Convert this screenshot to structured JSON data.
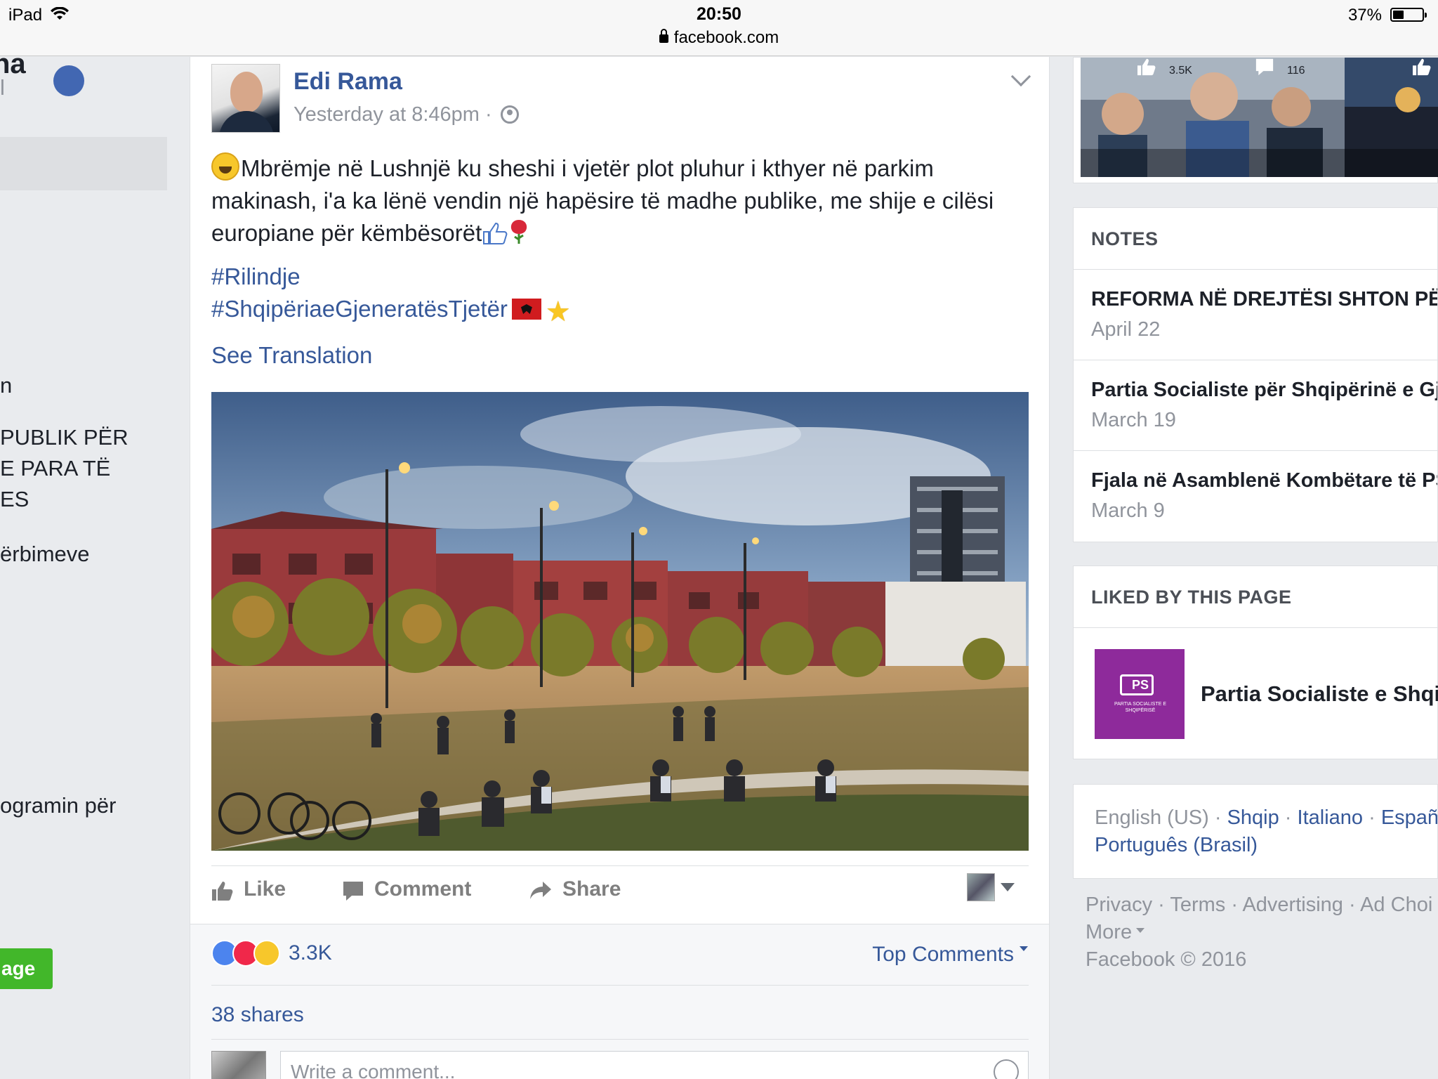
{
  "status_bar": {
    "device": "iPad",
    "time": "20:50",
    "url": "facebook.com",
    "battery": "37%"
  },
  "left_sidebar": {
    "partial_title": "na",
    "partial_subtitle": "l",
    "lines": [
      "n",
      "PUBLIK PËR",
      "E PARA TË",
      "ES",
      "ërbimeve",
      "ogramin për"
    ],
    "green_button": "age"
  },
  "post": {
    "author": "Edi Rama",
    "timestamp": "Yesterday at 8:46pm",
    "dot": "·",
    "text": "Mbrëmje në Lushnjë ku sheshi i vjetër plot pluhur i kthyer në parkim makinash, i'a ka lënë vendin një hapësire të madhe publike, me shije e cilësi europiane për këmbësorët",
    "hashtags": [
      "#Rilindje",
      "#ShqipëriaeGjeneratësTjetër"
    ],
    "see_translation": "See Translation",
    "actions": {
      "like": "Like",
      "comment": "Comment",
      "share": "Share"
    },
    "reactions_count": "3.3K",
    "top_comments": "Top Comments",
    "shares": "38 shares",
    "comment_placeholder": "Write a comment..."
  },
  "right_column": {
    "video": {
      "likes": "3.5K",
      "comments": "116"
    },
    "notes": {
      "heading": "NOTES",
      "items": [
        {
          "title": "REFORMA NË DREJTËSI SHTON PËR",
          "date": "April 22"
        },
        {
          "title": "Partia Socialiste për Shqipërinë e Gj",
          "date": "March 19"
        },
        {
          "title": "Fjala në Asamblenë Kombëtare të PS",
          "date": "March 9"
        }
      ]
    },
    "liked": {
      "heading": "LIKED BY THIS PAGE",
      "page_name": "Partia Socialiste e Shqi",
      "logo_mark": "PS",
      "logo_text": "PARTIA SOCIALISTE E SHQIPËRISË"
    },
    "languages": {
      "current": "English (US)",
      "sep": " · ",
      "links": [
        "Shqip",
        "Italiano",
        "Españ",
        "Português (Brasil)"
      ]
    },
    "footer": {
      "links": [
        "Privacy",
        "Terms",
        "Advertising",
        "Ad Choi"
      ],
      "more": "More",
      "copyright": "Facebook © 2016"
    }
  },
  "colors": {
    "link": "#365899",
    "background": "#e9ebee",
    "green": "#42b72a",
    "ps_purple": "#8e2a9b"
  }
}
